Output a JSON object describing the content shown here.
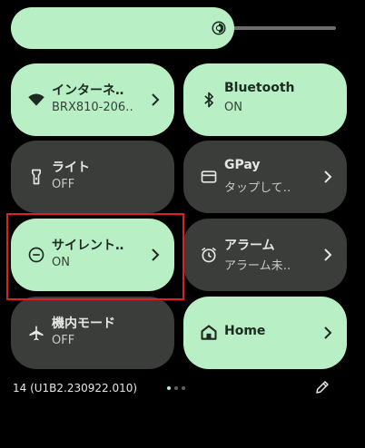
{
  "brightness": {
    "level": 0.65,
    "icon": "brightness-icon"
  },
  "tiles": [
    {
      "title": "インターネ‥",
      "subtitle": "BRX810-206‥",
      "state": "on",
      "icon": "wifi-icon",
      "chevron": true
    },
    {
      "title": "Bluetooth",
      "subtitle": "ON",
      "state": "on",
      "icon": "bluetooth-icon",
      "chevron": false
    },
    {
      "title": "ライト",
      "subtitle": "OFF",
      "state": "off",
      "icon": "flashlight-icon",
      "chevron": false
    },
    {
      "title": "GPay",
      "subtitle": "タップして‥",
      "state": "off",
      "icon": "wallet-card-icon",
      "chevron": true
    },
    {
      "title": "サイレント‥",
      "subtitle": "ON",
      "state": "on",
      "icon": "do-not-disturb-icon",
      "chevron": true
    },
    {
      "title": "アラーム",
      "subtitle": "アラーム未‥",
      "state": "off",
      "icon": "alarm-clock-icon",
      "chevron": true
    },
    {
      "title": "機内モード",
      "subtitle": "OFF",
      "state": "off",
      "icon": "airplane-icon",
      "chevron": false
    },
    {
      "title": "Home",
      "state": "on",
      "icon": "home-icon",
      "chevron": true
    }
  ],
  "footer": {
    "build": "14 (U1B2.230922.010)",
    "page_indicator": {
      "count": 3,
      "active": 0
    },
    "edit_icon": "pencil-icon"
  },
  "colors": {
    "background": "#000000",
    "tile_on": "#b8efc4",
    "tile_off": "#3a3d3a",
    "highlight": "#e0201e"
  }
}
